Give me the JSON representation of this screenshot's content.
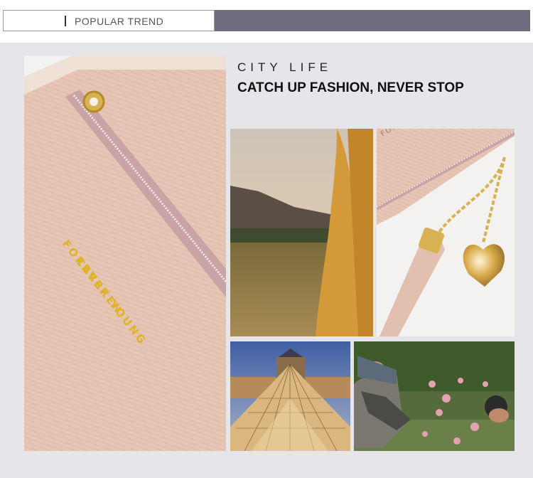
{
  "header": {
    "section_label": "POPULAR TREND",
    "accent_color": "#6e6d80"
  },
  "hero": {
    "brand_line1": "FOREVER YOUNG",
    "brand_line2": "CARRKEN",
    "wallet_color": "#e6c5b4",
    "gold_color": "#e0b227"
  },
  "copy": {
    "tagline": "CITY LIFE",
    "headline": "CATCH UP FASHION, NEVER STOP"
  },
  "gallery": {
    "wallet_corner_text": "FOREVER"
  }
}
